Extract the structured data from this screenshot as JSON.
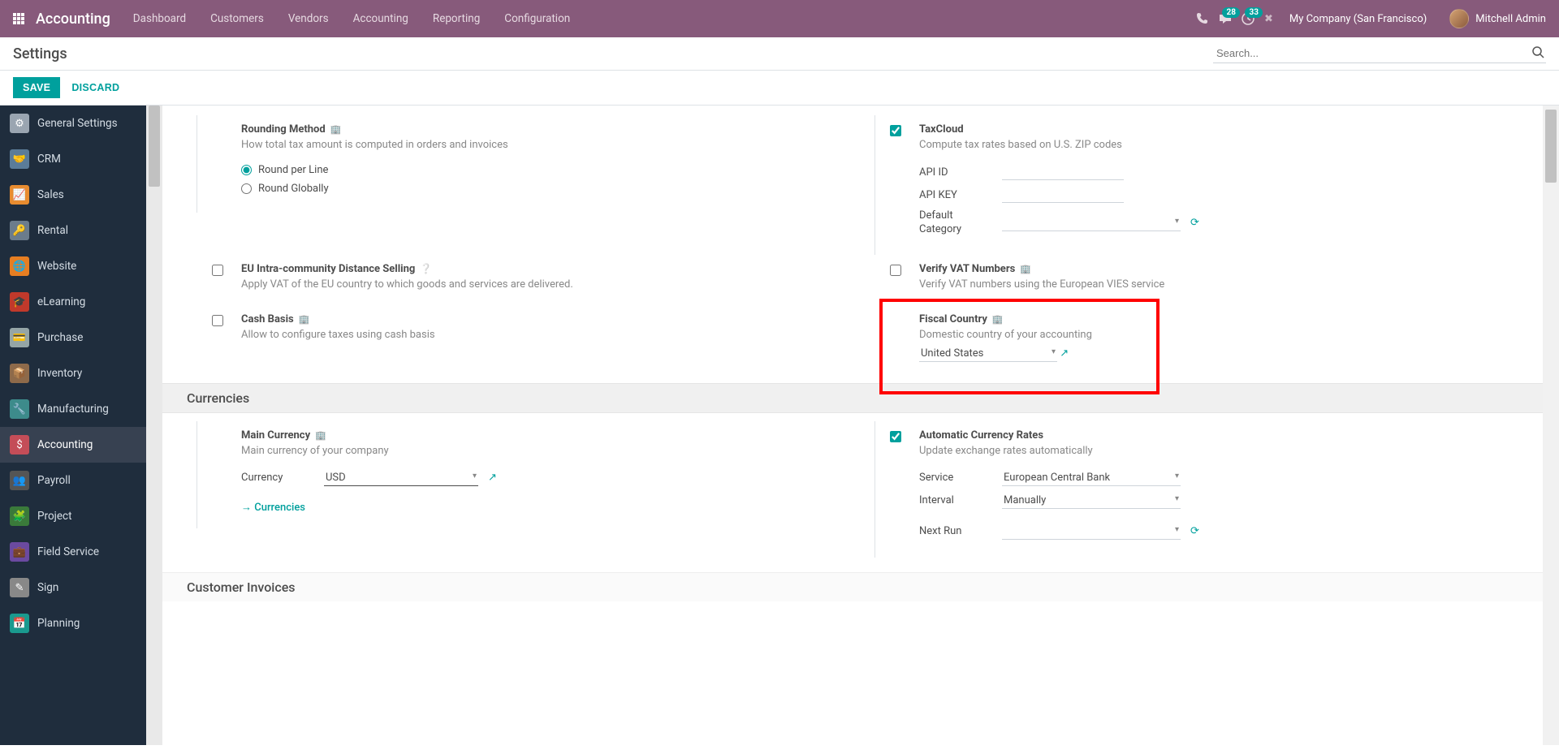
{
  "navbar": {
    "brand": "Accounting",
    "menu": [
      "Dashboard",
      "Customers",
      "Vendors",
      "Accounting",
      "Reporting",
      "Configuration"
    ],
    "badges": {
      "messages": "28",
      "activities": "33"
    },
    "company": "My Company (San Francisco)",
    "user": "Mitchell Admin"
  },
  "page": {
    "title": "Settings",
    "search_placeholder": "Search...",
    "save": "SAVE",
    "discard": "DISCARD"
  },
  "sidebar": {
    "items": [
      {
        "label": "General Settings"
      },
      {
        "label": "CRM"
      },
      {
        "label": "Sales"
      },
      {
        "label": "Rental"
      },
      {
        "label": "Website"
      },
      {
        "label": "eLearning"
      },
      {
        "label": "Purchase"
      },
      {
        "label": "Inventory"
      },
      {
        "label": "Manufacturing"
      },
      {
        "label": "Accounting",
        "active": true
      },
      {
        "label": "Payroll"
      },
      {
        "label": "Project"
      },
      {
        "label": "Field Service"
      },
      {
        "label": "Sign"
      },
      {
        "label": "Planning"
      }
    ]
  },
  "settings": {
    "rounding": {
      "title": "Rounding Method",
      "desc": "How total tax amount is computed in orders and invoices",
      "opt1": "Round per Line",
      "opt2": "Round Globally"
    },
    "taxcloud": {
      "title": "TaxCloud",
      "desc": "Compute tax rates based on U.S. ZIP codes",
      "api_id": "API ID",
      "api_key": "API KEY",
      "default_cat": "Default Category"
    },
    "eu": {
      "title": "EU Intra-community Distance Selling",
      "desc": "Apply VAT of the EU country to which goods and services are delivered."
    },
    "vat": {
      "title": "Verify VAT Numbers",
      "desc": "Verify VAT numbers using the European VIES service"
    },
    "cash": {
      "title": "Cash Basis",
      "desc": "Allow to configure taxes using cash basis"
    },
    "fiscal": {
      "title": "Fiscal Country",
      "desc": "Domestic country of your accounting",
      "value": "United States"
    },
    "section_currencies": "Currencies",
    "main_currency": {
      "title": "Main Currency",
      "desc": "Main currency of your company",
      "label": "Currency",
      "value": "USD",
      "link": "Currencies"
    },
    "auto_rates": {
      "title": "Automatic Currency Rates",
      "desc": "Update exchange rates automatically",
      "service_label": "Service",
      "service_value": "European Central Bank",
      "interval_label": "Interval",
      "interval_value": "Manually",
      "nextrun_label": "Next Run"
    },
    "section_invoices": "Customer Invoices"
  }
}
